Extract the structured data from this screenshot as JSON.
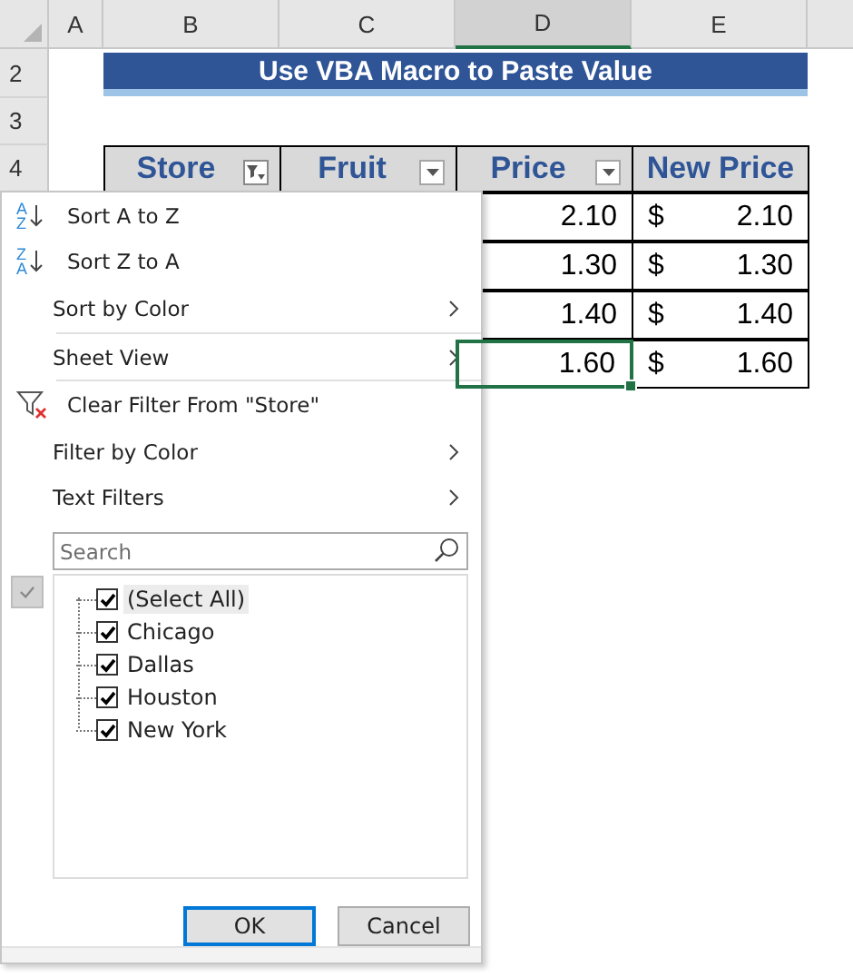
{
  "columns": [
    {
      "label": "A",
      "selected": false
    },
    {
      "label": "B",
      "selected": false
    },
    {
      "label": "C",
      "selected": false
    },
    {
      "label": "D",
      "selected": true
    },
    {
      "label": "E",
      "selected": false
    }
  ],
  "row_numbers": [
    "2",
    "3",
    "4"
  ],
  "title": "Use VBA Macro to Paste Value",
  "headers": [
    {
      "label": "Store",
      "filter_button": true,
      "filtered": true
    },
    {
      "label": "Fruit",
      "filter_button": true,
      "filtered": false
    },
    {
      "label": "Price",
      "filter_button": true,
      "filtered": false
    },
    {
      "label": "New Price",
      "filter_button": false,
      "filtered": false
    }
  ],
  "rows": [
    {
      "price": "2.10",
      "currency": "$",
      "new_price": "2.10",
      "selected": false
    },
    {
      "price": "1.30",
      "currency": "$",
      "new_price": "1.30",
      "selected": false
    },
    {
      "price": "1.40",
      "currency": "$",
      "new_price": "1.40",
      "selected": false
    },
    {
      "price": "1.60",
      "currency": "$",
      "new_price": "1.60",
      "selected": true
    }
  ],
  "filter_menu": {
    "items": [
      {
        "kind": "sort",
        "label": "Sort A to Z",
        "icon_top": "A",
        "icon_bottom": "Z"
      },
      {
        "kind": "sort",
        "label": "Sort Z to A",
        "icon_top": "Z",
        "icon_bottom": "A"
      },
      {
        "kind": "submenu",
        "label": "Sort by Color"
      },
      {
        "kind": "separator"
      },
      {
        "kind": "submenu",
        "label": "Sheet View"
      },
      {
        "kind": "separator"
      },
      {
        "kind": "clear",
        "label": "Clear Filter From \"Store\""
      },
      {
        "kind": "submenu",
        "label": "Filter by Color"
      },
      {
        "kind": "submenu",
        "label": "Text Filters"
      }
    ],
    "search": {
      "placeholder": "Search"
    },
    "values": [
      {
        "label": "(Select All)",
        "checked": true,
        "selected": true
      },
      {
        "label": "Chicago",
        "checked": true,
        "selected": false
      },
      {
        "label": "Dallas",
        "checked": true,
        "selected": false
      },
      {
        "label": "Houston",
        "checked": true,
        "selected": false
      },
      {
        "label": "New York",
        "checked": true,
        "selected": false
      }
    ],
    "buttons": [
      {
        "label": "OK",
        "selected": true
      },
      {
        "label": "Cancel",
        "selected": false
      }
    ]
  }
}
